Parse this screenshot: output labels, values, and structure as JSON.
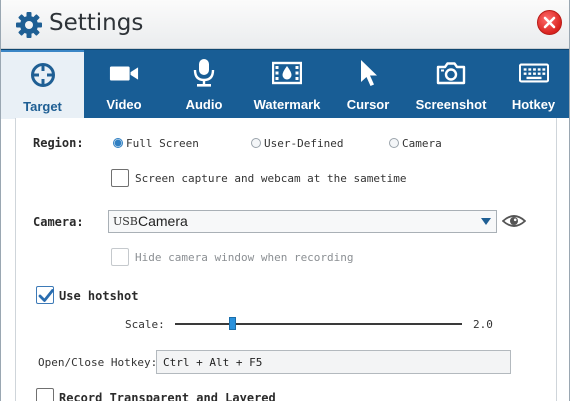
{
  "window": {
    "title": "Settings"
  },
  "tabs": [
    {
      "label": "Target",
      "icon": "crosshair-icon",
      "active": true
    },
    {
      "label": "Video",
      "icon": "video-camera-icon",
      "active": false
    },
    {
      "label": "Audio",
      "icon": "microphone-icon",
      "active": false
    },
    {
      "label": "Watermark",
      "icon": "watermark-film-icon",
      "active": false
    },
    {
      "label": "Cursor",
      "icon": "cursor-arrow-icon",
      "active": false
    },
    {
      "label": "Screenshot",
      "icon": "camera-icon",
      "active": false
    },
    {
      "label": "Hotkey",
      "icon": "keyboard-icon",
      "active": false
    }
  ],
  "region": {
    "label": "Region:",
    "options": [
      {
        "label": "Full Screen",
        "selected": true
      },
      {
        "label": "User-Defined",
        "selected": false
      },
      {
        "label": "Camera",
        "selected": false
      }
    ],
    "webcam_checkbox": {
      "label": "Screen capture and webcam at the sametime",
      "checked": false
    }
  },
  "camera": {
    "label": "Camera:",
    "selected_prefix": "USB",
    "selected_value": "Camera",
    "hide_checkbox": {
      "label": "Hide camera window when recording",
      "checked": false,
      "disabled": true
    }
  },
  "hotshot": {
    "label": "Use hotshot",
    "checked": true,
    "scale_label": "Scale:",
    "scale_value": "2.0",
    "scale_fraction": 0.2,
    "hotkey_label": "Open/Close Hotkey:",
    "hotkey_value": "Ctrl + Alt + F5"
  },
  "transparent_checkbox": {
    "label": "Record Transparent and Layered",
    "checked": false
  },
  "colors": {
    "tab_bar": "#185d95",
    "active_tab_bg": "#e9f0f6",
    "close": "#d9231f",
    "accent": "#2a91dc"
  }
}
